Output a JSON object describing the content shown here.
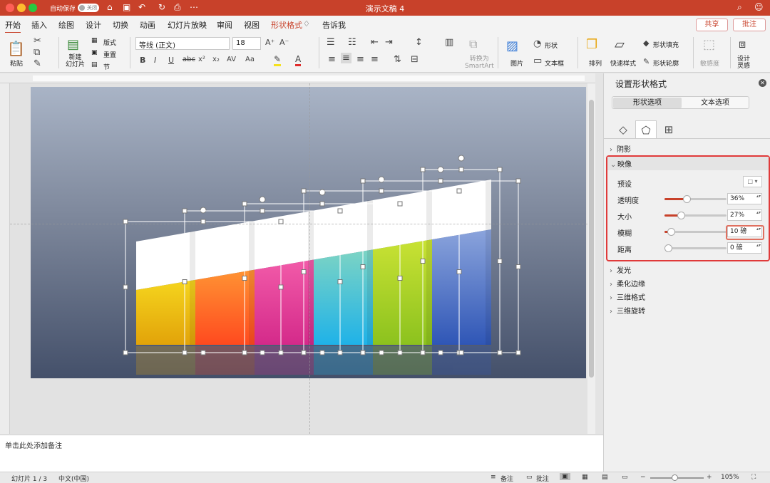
{
  "titlebar": {
    "autosave_label": "自动保存",
    "autosave_state": "关闭",
    "doc_title": "演示文稿 4"
  },
  "tabs": [
    "开始",
    "插入",
    "绘图",
    "设计",
    "切换",
    "动画",
    "幻灯片放映",
    "审阅",
    "视图",
    "形状格式",
    "告诉我"
  ],
  "header_buttons": {
    "share": "共享",
    "comment": "批注"
  },
  "ribbon": {
    "paste": "粘贴",
    "new_slide": "新建\n幻灯片",
    "layout": "版式",
    "reset": "重置",
    "section": "节",
    "font_name": "等线 (正文)",
    "font_size": "18",
    "convert_smartart": "转换为\nSmartArt",
    "picture": "图片",
    "shape": "形状",
    "textbox": "文本框",
    "arrange": "排列",
    "quick_styles": "快速样式",
    "shape_fill": "形状填充",
    "shape_outline": "形状轮廓",
    "sensitivity": "敏感度",
    "designer": "设计\n灵感"
  },
  "notes_placeholder": "单击此处添加备注",
  "status": {
    "slide": "幻灯片 1 / 3",
    "language": "中文(中国)",
    "notes": "备注",
    "comments": "批注",
    "zoom": "105%"
  },
  "pane": {
    "title": "设置形状格式",
    "segments": [
      "形状选项",
      "文本选项"
    ],
    "sections": {
      "shadow": "阴影",
      "reflection": "映像",
      "glow": "发光",
      "soft_edges": "柔化边缘",
      "format_3d": "三维格式",
      "rotation_3d": "三维旋转"
    },
    "reflection": {
      "preset": "预设",
      "transparency": {
        "label": "透明度",
        "value": "36%",
        "level": 0.36
      },
      "size": {
        "label": "大小",
        "value": "27%",
        "level": 0.27
      },
      "blur": {
        "label": "模糊",
        "value": "10 磅",
        "level": 0.1
      },
      "distance": {
        "label": "距离",
        "value": "0 磅",
        "level": 0
      }
    }
  },
  "slide_bars": {
    "colors": [
      [
        "#f5d51e",
        "#e2a309"
      ],
      [
        "#ff9333",
        "#ff4a1f"
      ],
      [
        "#f25ba9",
        "#d42a8a"
      ],
      [
        "#7dd4c4",
        "#1fb2e8"
      ],
      [
        "#c9e234",
        "#8cc21e"
      ],
      [
        "#8ba4dc",
        "#2f56b6"
      ]
    ]
  }
}
